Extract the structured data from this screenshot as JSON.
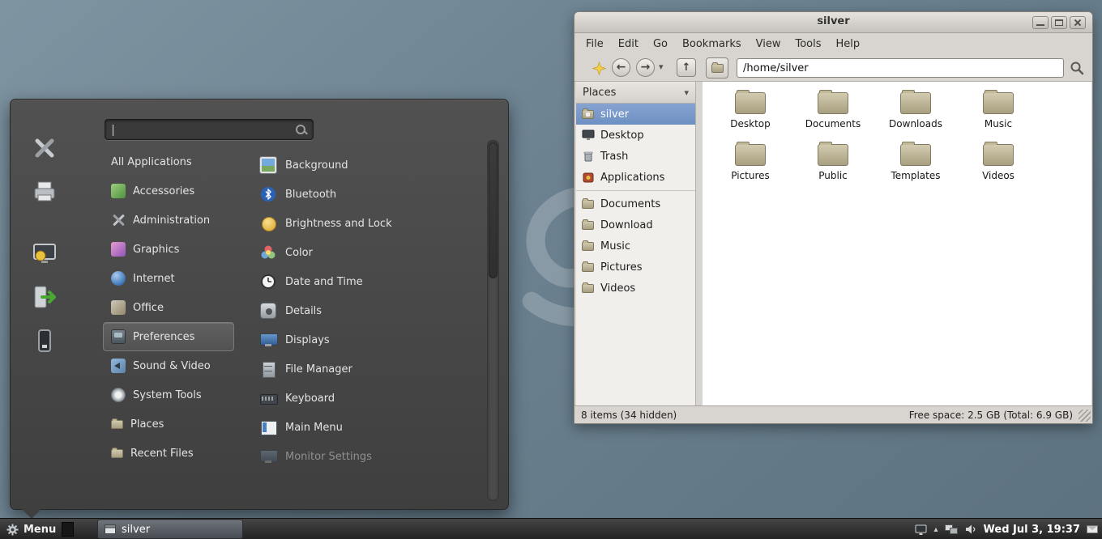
{
  "glyphs": {
    "back": "←",
    "forward": "→",
    "up": "↑",
    "dropdown": "▾",
    "chevron_up": "▴"
  },
  "colors": {
    "desktop": "#6d8290",
    "menu_bg": "#464646",
    "chrome": "#d8d4cf",
    "selection_blue": "#7493c4",
    "folder_tan": "#b3aa8c"
  },
  "menu": {
    "search_placeholder": "",
    "side_buttons": [
      "software-tools",
      "printer",
      "display-settings",
      "logout",
      "shutdown"
    ],
    "categories": [
      {
        "label": "All Applications",
        "icon": "none"
      },
      {
        "label": "Accessories",
        "icon": "accessories"
      },
      {
        "label": "Administration",
        "icon": "crossed-tools"
      },
      {
        "label": "Graphics",
        "icon": "graphics"
      },
      {
        "label": "Internet",
        "icon": "globe"
      },
      {
        "label": "Office",
        "icon": "office"
      },
      {
        "label": "Preferences",
        "icon": "control-panel",
        "selected": true
      },
      {
        "label": "Sound & Video",
        "icon": "speaker"
      },
      {
        "label": "System Tools",
        "icon": "gear"
      },
      {
        "label": "Places",
        "icon": "folder"
      },
      {
        "label": "Recent Files",
        "icon": "folder"
      }
    ],
    "applications": [
      {
        "label": "Background",
        "icon": "wallpaper"
      },
      {
        "label": "Bluetooth",
        "icon": "bluetooth"
      },
      {
        "label": "Brightness and Lock",
        "icon": "brightness"
      },
      {
        "label": "Color",
        "icon": "color-profile"
      },
      {
        "label": "Date and Time",
        "icon": "clock"
      },
      {
        "label": "Details",
        "icon": "system"
      },
      {
        "label": "Displays",
        "icon": "monitor"
      },
      {
        "label": "File Manager",
        "icon": "file-cabinet"
      },
      {
        "label": "Keyboard",
        "icon": "keyboard"
      },
      {
        "label": "Main Menu",
        "icon": "menu-editor"
      },
      {
        "label": "Monitor Settings",
        "icon": "monitor",
        "disabled": true
      }
    ]
  },
  "window": {
    "title": "silver",
    "menubar": [
      "File",
      "Edit",
      "Go",
      "Bookmarks",
      "View",
      "Tools",
      "Help"
    ],
    "toolbar": {
      "location": "/home/silver"
    },
    "sidebar": {
      "header": "Places",
      "items": [
        {
          "label": "silver",
          "icon": "home-folder",
          "selected": true
        },
        {
          "label": "Desktop",
          "icon": "desktop"
        },
        {
          "label": "Trash",
          "icon": "trash"
        },
        {
          "label": "Applications",
          "icon": "applications"
        },
        {
          "label": "Documents",
          "icon": "folder"
        },
        {
          "label": "Download",
          "icon": "folder"
        },
        {
          "label": "Music",
          "icon": "folder"
        },
        {
          "label": "Pictures",
          "icon": "folder"
        },
        {
          "label": "Videos",
          "icon": "folder"
        }
      ]
    },
    "files": [
      "Desktop",
      "Documents",
      "Downloads",
      "Music",
      "Pictures",
      "Public",
      "Templates",
      "Videos"
    ],
    "status_left": "8 items (34 hidden)",
    "status_right": "Free space: 2.5 GB (Total: 6.9 GB)"
  },
  "panel": {
    "menu_label": "Menu",
    "task_label": "silver",
    "clock": "Wed Jul 3, 19:37"
  }
}
